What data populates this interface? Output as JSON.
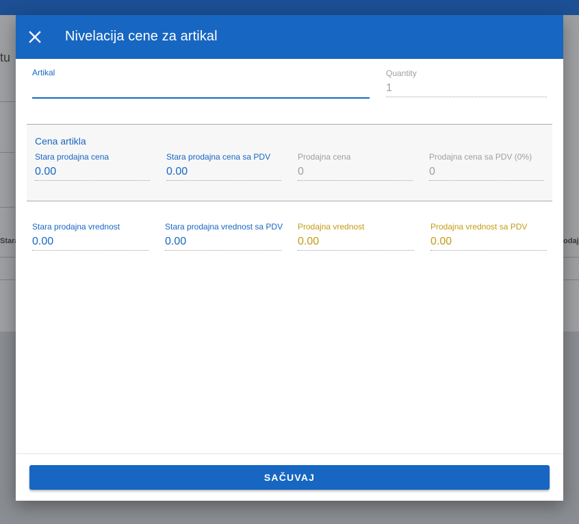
{
  "background": {
    "title_fragment": "tu",
    "left_column_fragment": "Stara",
    "right_column_fragment": "odaj"
  },
  "modal": {
    "title": "Nivelacija cene za artikal",
    "close_icon": "close-icon",
    "artikal": {
      "label": "Artikal",
      "value": ""
    },
    "quantity": {
      "label": "Quantity",
      "value": "1"
    },
    "section": {
      "title": "Cena artikla",
      "fields": [
        {
          "label": "Stara prodajna cena",
          "value": "0.00"
        },
        {
          "label": "Stara prodajna cena sa PDV",
          "value": "0.00"
        },
        {
          "label": "Prodajna cena",
          "value": "0"
        },
        {
          "label": "Prodajna cena sa PDV (0%)",
          "value": "0"
        }
      ]
    },
    "values": [
      {
        "label": "Stara prodajna vrednost",
        "value": "0.00"
      },
      {
        "label": "Stara prodajna vrednost sa PDV",
        "value": "0.00"
      },
      {
        "label": "Prodajna vrednost",
        "value": "0.00"
      },
      {
        "label": "Prodajna vrednost sa PDV",
        "value": "0.00"
      }
    ],
    "save_label": "SAČUVAJ"
  },
  "colors": {
    "primary": "#1766c2",
    "muted": "#9e9e9e",
    "highlight": "#c49a12"
  }
}
